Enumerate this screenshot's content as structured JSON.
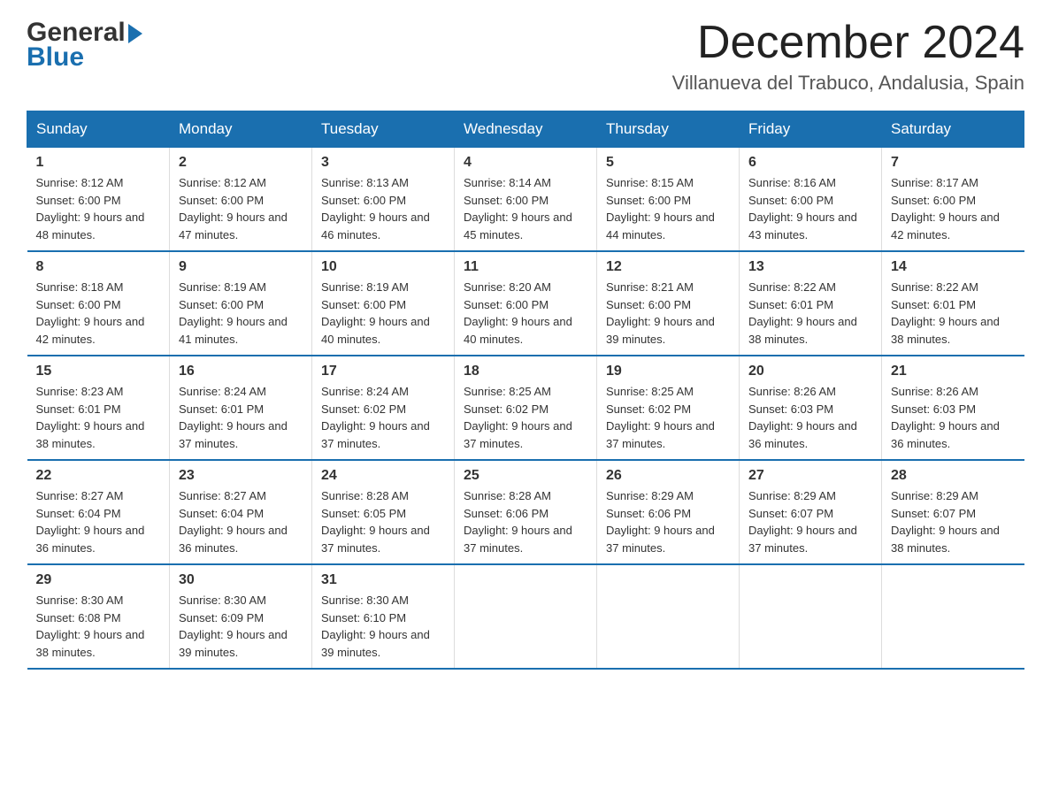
{
  "header": {
    "logo_part1": "General",
    "logo_part2": "Blue",
    "month": "December 2024",
    "location": "Villanueva del Trabuco, Andalusia, Spain"
  },
  "days_of_week": [
    "Sunday",
    "Monday",
    "Tuesday",
    "Wednesday",
    "Thursday",
    "Friday",
    "Saturday"
  ],
  "weeks": [
    [
      {
        "day": "1",
        "sunrise": "8:12 AM",
        "sunset": "6:00 PM",
        "daylight": "9 hours and 48 minutes."
      },
      {
        "day": "2",
        "sunrise": "8:12 AM",
        "sunset": "6:00 PM",
        "daylight": "9 hours and 47 minutes."
      },
      {
        "day": "3",
        "sunrise": "8:13 AM",
        "sunset": "6:00 PM",
        "daylight": "9 hours and 46 minutes."
      },
      {
        "day": "4",
        "sunrise": "8:14 AM",
        "sunset": "6:00 PM",
        "daylight": "9 hours and 45 minutes."
      },
      {
        "day": "5",
        "sunrise": "8:15 AM",
        "sunset": "6:00 PM",
        "daylight": "9 hours and 44 minutes."
      },
      {
        "day": "6",
        "sunrise": "8:16 AM",
        "sunset": "6:00 PM",
        "daylight": "9 hours and 43 minutes."
      },
      {
        "day": "7",
        "sunrise": "8:17 AM",
        "sunset": "6:00 PM",
        "daylight": "9 hours and 42 minutes."
      }
    ],
    [
      {
        "day": "8",
        "sunrise": "8:18 AM",
        "sunset": "6:00 PM",
        "daylight": "9 hours and 42 minutes."
      },
      {
        "day": "9",
        "sunrise": "8:19 AM",
        "sunset": "6:00 PM",
        "daylight": "9 hours and 41 minutes."
      },
      {
        "day": "10",
        "sunrise": "8:19 AM",
        "sunset": "6:00 PM",
        "daylight": "9 hours and 40 minutes."
      },
      {
        "day": "11",
        "sunrise": "8:20 AM",
        "sunset": "6:00 PM",
        "daylight": "9 hours and 40 minutes."
      },
      {
        "day": "12",
        "sunrise": "8:21 AM",
        "sunset": "6:00 PM",
        "daylight": "9 hours and 39 minutes."
      },
      {
        "day": "13",
        "sunrise": "8:22 AM",
        "sunset": "6:01 PM",
        "daylight": "9 hours and 38 minutes."
      },
      {
        "day": "14",
        "sunrise": "8:22 AM",
        "sunset": "6:01 PM",
        "daylight": "9 hours and 38 minutes."
      }
    ],
    [
      {
        "day": "15",
        "sunrise": "8:23 AM",
        "sunset": "6:01 PM",
        "daylight": "9 hours and 38 minutes."
      },
      {
        "day": "16",
        "sunrise": "8:24 AM",
        "sunset": "6:01 PM",
        "daylight": "9 hours and 37 minutes."
      },
      {
        "day": "17",
        "sunrise": "8:24 AM",
        "sunset": "6:02 PM",
        "daylight": "9 hours and 37 minutes."
      },
      {
        "day": "18",
        "sunrise": "8:25 AM",
        "sunset": "6:02 PM",
        "daylight": "9 hours and 37 minutes."
      },
      {
        "day": "19",
        "sunrise": "8:25 AM",
        "sunset": "6:02 PM",
        "daylight": "9 hours and 37 minutes."
      },
      {
        "day": "20",
        "sunrise": "8:26 AM",
        "sunset": "6:03 PM",
        "daylight": "9 hours and 36 minutes."
      },
      {
        "day": "21",
        "sunrise": "8:26 AM",
        "sunset": "6:03 PM",
        "daylight": "9 hours and 36 minutes."
      }
    ],
    [
      {
        "day": "22",
        "sunrise": "8:27 AM",
        "sunset": "6:04 PM",
        "daylight": "9 hours and 36 minutes."
      },
      {
        "day": "23",
        "sunrise": "8:27 AM",
        "sunset": "6:04 PM",
        "daylight": "9 hours and 36 minutes."
      },
      {
        "day": "24",
        "sunrise": "8:28 AM",
        "sunset": "6:05 PM",
        "daylight": "9 hours and 37 minutes."
      },
      {
        "day": "25",
        "sunrise": "8:28 AM",
        "sunset": "6:06 PM",
        "daylight": "9 hours and 37 minutes."
      },
      {
        "day": "26",
        "sunrise": "8:29 AM",
        "sunset": "6:06 PM",
        "daylight": "9 hours and 37 minutes."
      },
      {
        "day": "27",
        "sunrise": "8:29 AM",
        "sunset": "6:07 PM",
        "daylight": "9 hours and 37 minutes."
      },
      {
        "day": "28",
        "sunrise": "8:29 AM",
        "sunset": "6:07 PM",
        "daylight": "9 hours and 38 minutes."
      }
    ],
    [
      {
        "day": "29",
        "sunrise": "8:30 AM",
        "sunset": "6:08 PM",
        "daylight": "9 hours and 38 minutes."
      },
      {
        "day": "30",
        "sunrise": "8:30 AM",
        "sunset": "6:09 PM",
        "daylight": "9 hours and 39 minutes."
      },
      {
        "day": "31",
        "sunrise": "8:30 AM",
        "sunset": "6:10 PM",
        "daylight": "9 hours and 39 minutes."
      },
      null,
      null,
      null,
      null
    ]
  ]
}
